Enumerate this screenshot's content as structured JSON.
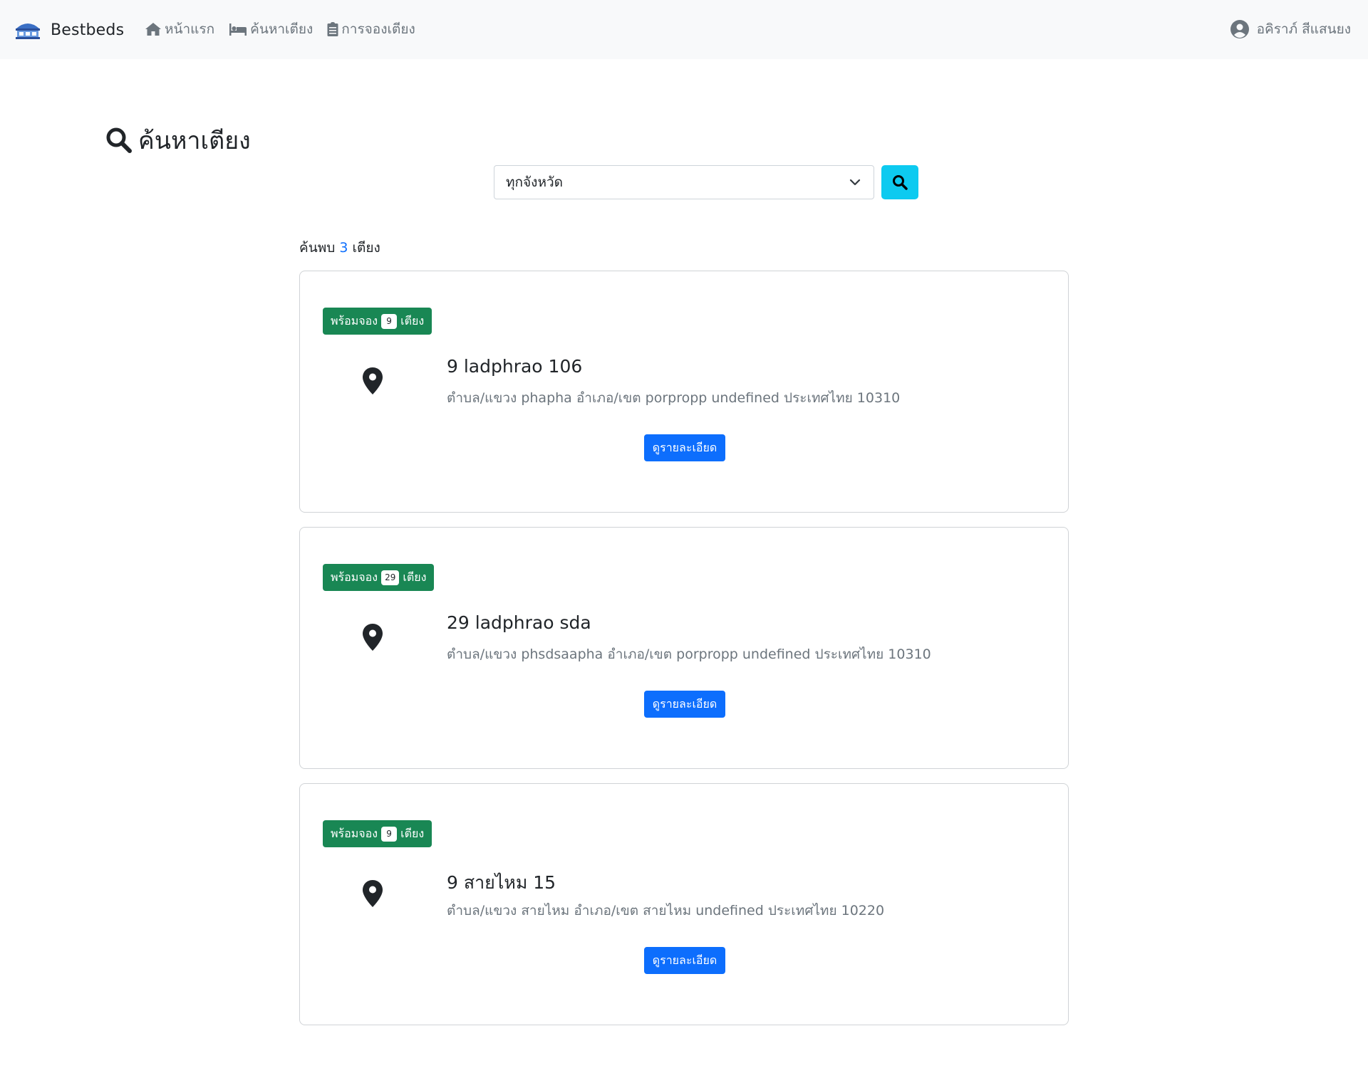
{
  "navbar": {
    "brand": "Bestbeds",
    "links": [
      {
        "label": "หน้าแรก",
        "icon": "home-icon"
      },
      {
        "label": "ค้นหาเตียง",
        "icon": "bed-icon"
      },
      {
        "label": "การจองเตียง",
        "icon": "clipboard-icon"
      }
    ],
    "user": {
      "name": "อคิราภ์ สีแสนยง",
      "icon": "user-circle-icon"
    }
  },
  "page": {
    "title": "ค้นหาเตียง",
    "title_icon": "search-icon"
  },
  "search": {
    "province_selected": "ทุกจังหวัด",
    "button_icon": "search-icon"
  },
  "results": {
    "prefix": "ค้นพบ",
    "count": "3",
    "suffix": "เตียง"
  },
  "cards": [
    {
      "badge_prefix": "พร้อมจอง",
      "badge_count": "9",
      "badge_suffix": "เตียง",
      "title": "9 ladphrao 106",
      "address": "ตำบล/แขวง phapha อำเภอ/เขต porpropp undefined ประเทศไทย 10310",
      "button": "ดูรายละเอียด"
    },
    {
      "badge_prefix": "พร้อมจอง",
      "badge_count": "29",
      "badge_suffix": "เตียง",
      "title": "29 ladphrao sda",
      "address": "ตำบล/แขวง phsdsaapha อำเภอ/เขต porpropp undefined ประเทศไทย 10310",
      "button": "ดูรายละเอียด"
    },
    {
      "badge_prefix": "พร้อมจอง",
      "badge_count": "9",
      "badge_suffix": "เตียง",
      "title": "9 สายไหม 15",
      "address": "ตำบล/แขวง สายไหม อำเภอ/เขต สายไหม undefined ประเทศไทย 10220",
      "button": "ดูรายละเอียด"
    }
  ],
  "colors": {
    "navbar_bg": "#f8f9fa",
    "badge_green": "#198754",
    "primary_blue": "#0d6efd",
    "info_cyan": "#0dcaf0"
  }
}
